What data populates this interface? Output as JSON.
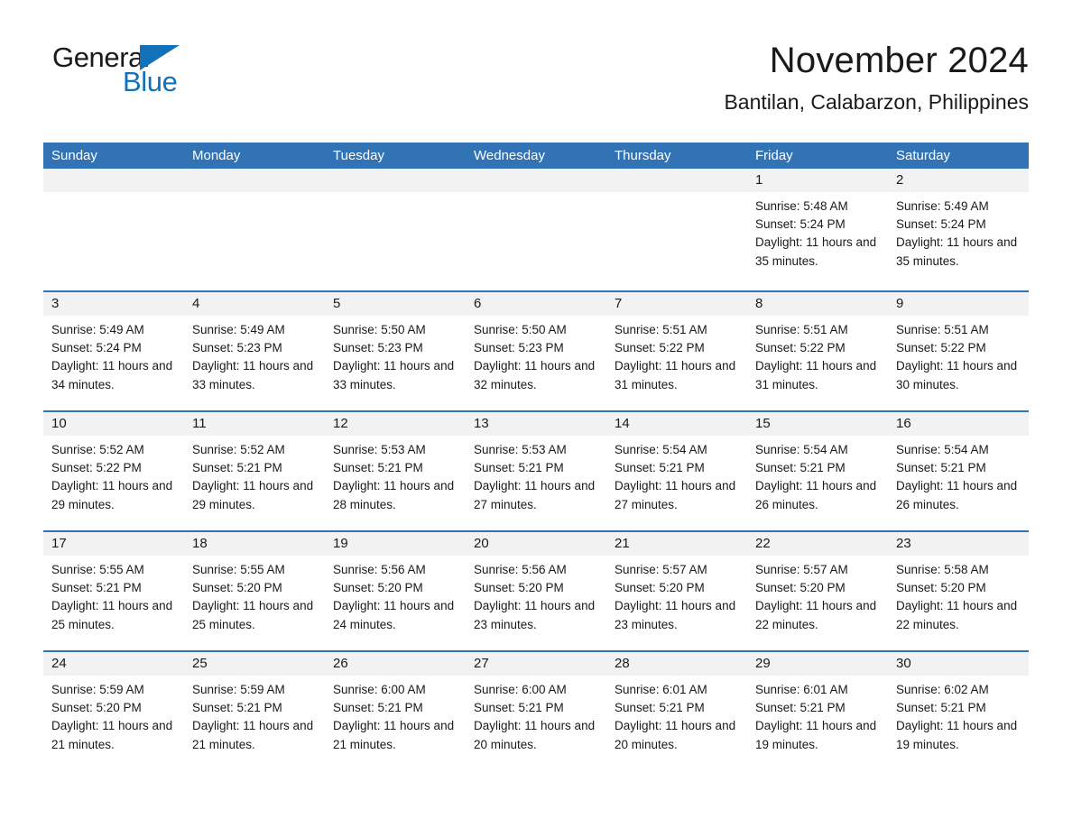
{
  "brand": {
    "name_part1": "General",
    "name_part2": "Blue",
    "accent_color": "#1271b8"
  },
  "header": {
    "month_title": "November 2024",
    "location": "Bantilan, Calabarzon, Philippines"
  },
  "calendar": {
    "header_color": "#3173b5",
    "day_band_color": "#f2f2f2",
    "weekdays": [
      "Sunday",
      "Monday",
      "Tuesday",
      "Wednesday",
      "Thursday",
      "Friday",
      "Saturday"
    ],
    "weeks": [
      [
        {
          "day": "",
          "sunrise": "",
          "sunset": "",
          "daylight": ""
        },
        {
          "day": "",
          "sunrise": "",
          "sunset": "",
          "daylight": ""
        },
        {
          "day": "",
          "sunrise": "",
          "sunset": "",
          "daylight": ""
        },
        {
          "day": "",
          "sunrise": "",
          "sunset": "",
          "daylight": ""
        },
        {
          "day": "",
          "sunrise": "",
          "sunset": "",
          "daylight": ""
        },
        {
          "day": "1",
          "sunrise": "Sunrise: 5:48 AM",
          "sunset": "Sunset: 5:24 PM",
          "daylight": "Daylight: 11 hours and 35 minutes."
        },
        {
          "day": "2",
          "sunrise": "Sunrise: 5:49 AM",
          "sunset": "Sunset: 5:24 PM",
          "daylight": "Daylight: 11 hours and 35 minutes."
        }
      ],
      [
        {
          "day": "3",
          "sunrise": "Sunrise: 5:49 AM",
          "sunset": "Sunset: 5:24 PM",
          "daylight": "Daylight: 11 hours and 34 minutes."
        },
        {
          "day": "4",
          "sunrise": "Sunrise: 5:49 AM",
          "sunset": "Sunset: 5:23 PM",
          "daylight": "Daylight: 11 hours and 33 minutes."
        },
        {
          "day": "5",
          "sunrise": "Sunrise: 5:50 AM",
          "sunset": "Sunset: 5:23 PM",
          "daylight": "Daylight: 11 hours and 33 minutes."
        },
        {
          "day": "6",
          "sunrise": "Sunrise: 5:50 AM",
          "sunset": "Sunset: 5:23 PM",
          "daylight": "Daylight: 11 hours and 32 minutes."
        },
        {
          "day": "7",
          "sunrise": "Sunrise: 5:51 AM",
          "sunset": "Sunset: 5:22 PM",
          "daylight": "Daylight: 11 hours and 31 minutes."
        },
        {
          "day": "8",
          "sunrise": "Sunrise: 5:51 AM",
          "sunset": "Sunset: 5:22 PM",
          "daylight": "Daylight: 11 hours and 31 minutes."
        },
        {
          "day": "9",
          "sunrise": "Sunrise: 5:51 AM",
          "sunset": "Sunset: 5:22 PM",
          "daylight": "Daylight: 11 hours and 30 minutes."
        }
      ],
      [
        {
          "day": "10",
          "sunrise": "Sunrise: 5:52 AM",
          "sunset": "Sunset: 5:22 PM",
          "daylight": "Daylight: 11 hours and 29 minutes."
        },
        {
          "day": "11",
          "sunrise": "Sunrise: 5:52 AM",
          "sunset": "Sunset: 5:21 PM",
          "daylight": "Daylight: 11 hours and 29 minutes."
        },
        {
          "day": "12",
          "sunrise": "Sunrise: 5:53 AM",
          "sunset": "Sunset: 5:21 PM",
          "daylight": "Daylight: 11 hours and 28 minutes."
        },
        {
          "day": "13",
          "sunrise": "Sunrise: 5:53 AM",
          "sunset": "Sunset: 5:21 PM",
          "daylight": "Daylight: 11 hours and 27 minutes."
        },
        {
          "day": "14",
          "sunrise": "Sunrise: 5:54 AM",
          "sunset": "Sunset: 5:21 PM",
          "daylight": "Daylight: 11 hours and 27 minutes."
        },
        {
          "day": "15",
          "sunrise": "Sunrise: 5:54 AM",
          "sunset": "Sunset: 5:21 PM",
          "daylight": "Daylight: 11 hours and 26 minutes."
        },
        {
          "day": "16",
          "sunrise": "Sunrise: 5:54 AM",
          "sunset": "Sunset: 5:21 PM",
          "daylight": "Daylight: 11 hours and 26 minutes."
        }
      ],
      [
        {
          "day": "17",
          "sunrise": "Sunrise: 5:55 AM",
          "sunset": "Sunset: 5:21 PM",
          "daylight": "Daylight: 11 hours and 25 minutes."
        },
        {
          "day": "18",
          "sunrise": "Sunrise: 5:55 AM",
          "sunset": "Sunset: 5:20 PM",
          "daylight": "Daylight: 11 hours and 25 minutes."
        },
        {
          "day": "19",
          "sunrise": "Sunrise: 5:56 AM",
          "sunset": "Sunset: 5:20 PM",
          "daylight": "Daylight: 11 hours and 24 minutes."
        },
        {
          "day": "20",
          "sunrise": "Sunrise: 5:56 AM",
          "sunset": "Sunset: 5:20 PM",
          "daylight": "Daylight: 11 hours and 23 minutes."
        },
        {
          "day": "21",
          "sunrise": "Sunrise: 5:57 AM",
          "sunset": "Sunset: 5:20 PM",
          "daylight": "Daylight: 11 hours and 23 minutes."
        },
        {
          "day": "22",
          "sunrise": "Sunrise: 5:57 AM",
          "sunset": "Sunset: 5:20 PM",
          "daylight": "Daylight: 11 hours and 22 minutes."
        },
        {
          "day": "23",
          "sunrise": "Sunrise: 5:58 AM",
          "sunset": "Sunset: 5:20 PM",
          "daylight": "Daylight: 11 hours and 22 minutes."
        }
      ],
      [
        {
          "day": "24",
          "sunrise": "Sunrise: 5:59 AM",
          "sunset": "Sunset: 5:20 PM",
          "daylight": "Daylight: 11 hours and 21 minutes."
        },
        {
          "day": "25",
          "sunrise": "Sunrise: 5:59 AM",
          "sunset": "Sunset: 5:21 PM",
          "daylight": "Daylight: 11 hours and 21 minutes."
        },
        {
          "day": "26",
          "sunrise": "Sunrise: 6:00 AM",
          "sunset": "Sunset: 5:21 PM",
          "daylight": "Daylight: 11 hours and 21 minutes."
        },
        {
          "day": "27",
          "sunrise": "Sunrise: 6:00 AM",
          "sunset": "Sunset: 5:21 PM",
          "daylight": "Daylight: 11 hours and 20 minutes."
        },
        {
          "day": "28",
          "sunrise": "Sunrise: 6:01 AM",
          "sunset": "Sunset: 5:21 PM",
          "daylight": "Daylight: 11 hours and 20 minutes."
        },
        {
          "day": "29",
          "sunrise": "Sunrise: 6:01 AM",
          "sunset": "Sunset: 5:21 PM",
          "daylight": "Daylight: 11 hours and 19 minutes."
        },
        {
          "day": "30",
          "sunrise": "Sunrise: 6:02 AM",
          "sunset": "Sunset: 5:21 PM",
          "daylight": "Daylight: 11 hours and 19 minutes."
        }
      ]
    ]
  }
}
